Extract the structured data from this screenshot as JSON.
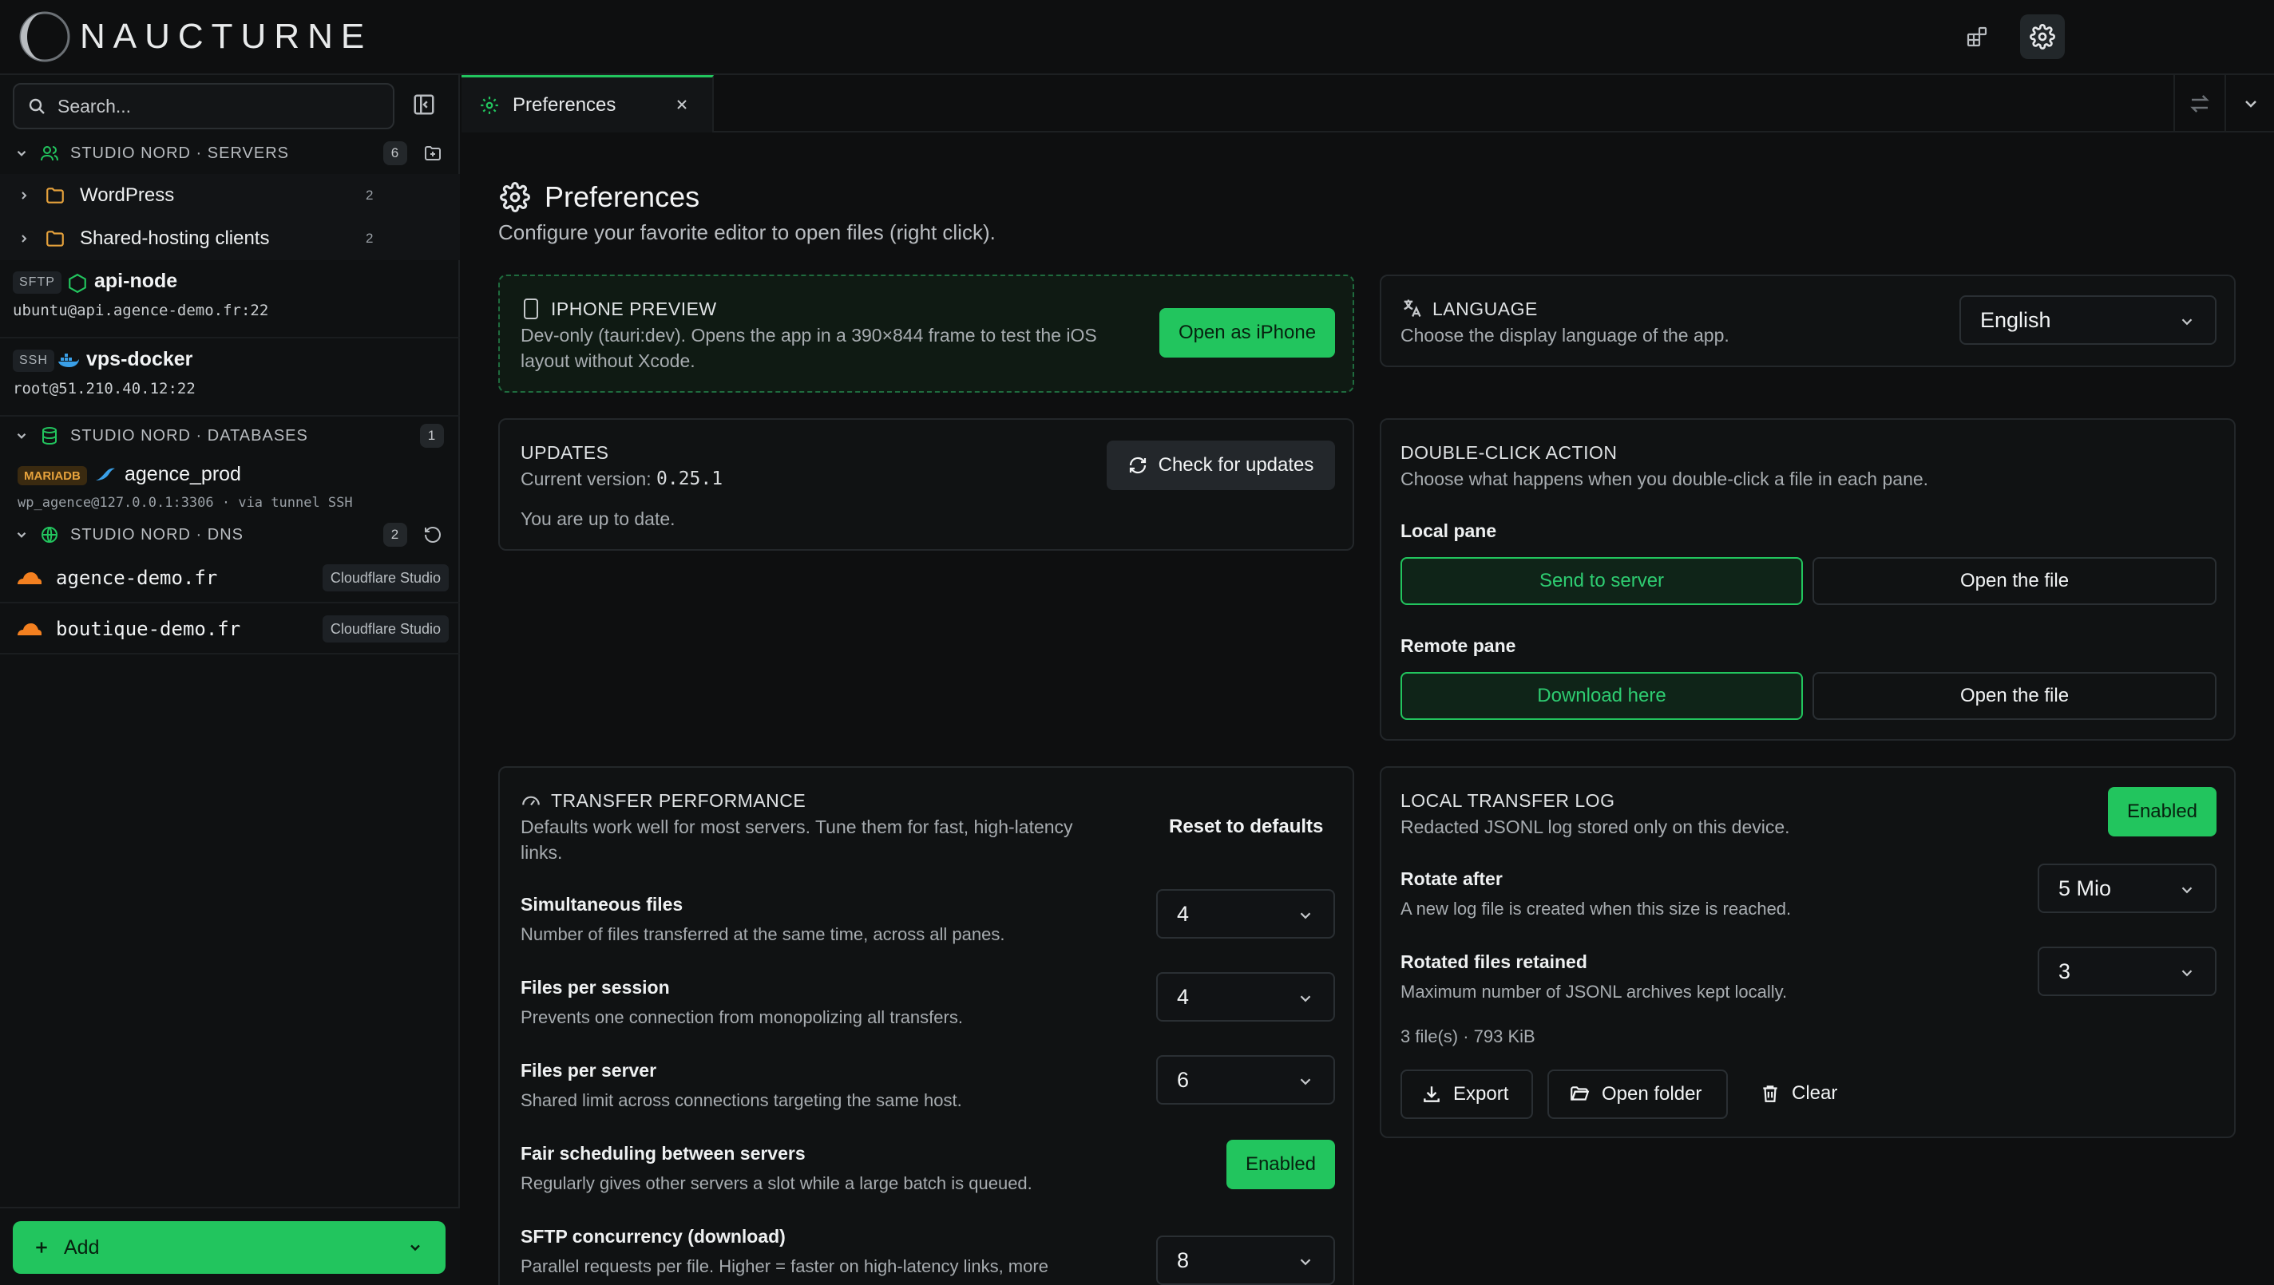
{
  "app": {
    "name": "NAUCTURNE"
  },
  "sidebar": {
    "search_placeholder": "Search...",
    "servers_group": {
      "label": "STUDIO NORD · SERVERS",
      "count": "6"
    },
    "folders": [
      {
        "name": "WordPress",
        "count": "2"
      },
      {
        "name": "Shared-hosting clients",
        "count": "2"
      }
    ],
    "servers": [
      {
        "protocol": "SFTP",
        "name": "api-node",
        "address": "ubuntu@api.agence-demo.fr:22"
      },
      {
        "protocol": "SSH",
        "name": "vps-docker",
        "address": "root@51.210.40.12:22"
      }
    ],
    "databases_group": {
      "label": "STUDIO NORD · DATABASES",
      "count": "1"
    },
    "database": {
      "engine": "MARIADB",
      "name": "agence_prod",
      "address": "wp_agence@127.0.0.1:3306 · via tunnel SSH"
    },
    "dns_group": {
      "label": "STUDIO NORD · DNS",
      "count": "2"
    },
    "dns": [
      {
        "name": "agence-demo.fr",
        "provider": "Cloudflare Studio"
      },
      {
        "name": "boutique-demo.fr",
        "provider": "Cloudflare Studio"
      }
    ],
    "add_label": "Add"
  },
  "tabs": [
    {
      "label": "Preferences"
    }
  ],
  "main": {
    "title": "Preferences",
    "subtitle": "Configure your favorite editor to open files (right click).",
    "iphone": {
      "title": "IPHONE PREVIEW",
      "desc_line1": "Dev-only (tauri:dev). Opens the app in a 390×844 frame to test the iOS",
      "desc_line2": "layout without Xcode.",
      "button": "Open as iPhone"
    },
    "language": {
      "title": "LANGUAGE",
      "desc": "Choose the display language of the app.",
      "value": "English"
    },
    "updates": {
      "title": "UPDATES",
      "current_label": "Current version:",
      "version": "0.25.1",
      "status": "You are up to date.",
      "button": "Check for updates"
    },
    "double_click": {
      "title": "DOUBLE-CLICK ACTION",
      "desc": "Choose what happens when you double-click a file in each pane.",
      "local_label": "Local pane",
      "local_options": [
        "Send to server",
        "Open the file"
      ],
      "remote_label": "Remote pane",
      "remote_options": [
        "Download here",
        "Open the file"
      ]
    },
    "transfer": {
      "title": "TRANSFER PERFORMANCE",
      "desc_line1": "Defaults work well for most servers. Tune them for fast, high-latency",
      "desc_line2": "links.",
      "reset": "Reset to defaults",
      "fields": [
        {
          "title": "Simultaneous files",
          "desc": "Number of files transferred at the same time, across all panes.",
          "value": "4"
        },
        {
          "title": "Files per session",
          "desc": "Prevents one connection from monopolizing all transfers.",
          "value": "4"
        },
        {
          "title": "Files per server",
          "desc": "Shared limit across connections targeting the same host.",
          "value": "6"
        }
      ],
      "fair": {
        "title": "Fair scheduling between servers",
        "desc": "Regularly gives other servers a slot while a large batch is queued.",
        "value": "Enabled"
      },
      "sftp": {
        "title": "SFTP concurrency (download)",
        "desc": "Parallel requests per file. Higher = faster on high-latency links, more",
        "value": "8"
      }
    },
    "log": {
      "title": "LOCAL TRANSFER LOG",
      "desc": "Redacted JSONL log stored only on this device.",
      "status": "Enabled",
      "rotate": {
        "title": "Rotate after",
        "desc": "A new log file is created when this size is reached.",
        "value": "5 Mio"
      },
      "retained": {
        "title": "Rotated files retained",
        "desc": "Maximum number of JSONL archives kept locally.",
        "value": "3"
      },
      "summary": "3 file(s) · 793 KiB",
      "actions": [
        "Export",
        "Open folder",
        "Clear"
      ]
    }
  },
  "colors": {
    "accent": "#22c55e",
    "background": "#0e0f10",
    "panel_border": "#23272a"
  }
}
